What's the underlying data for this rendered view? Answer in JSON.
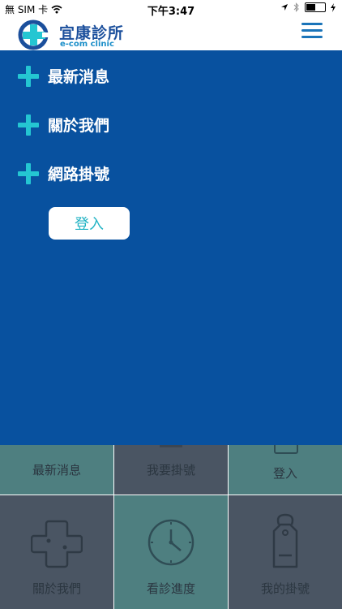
{
  "status_bar": {
    "carrier": "無 SIM 卡",
    "time": "下午3:47",
    "battery_level": 0.55
  },
  "header": {
    "title": "宜康診所",
    "subtitle": "e-com clinic",
    "logo_icon": "e-plus-logo-icon",
    "menu_icon": "hamburger-menu-icon"
  },
  "drawer": {
    "items": [
      {
        "label": "最新消息",
        "icon": "plus-icon"
      },
      {
        "label": "關於我們",
        "icon": "plus-icon"
      },
      {
        "label": "網路掛號",
        "icon": "plus-icon"
      }
    ],
    "login_label": "登入"
  },
  "grid": {
    "tiles": [
      {
        "label": "最新消息"
      },
      {
        "label": "我要掛號"
      },
      {
        "label": "登入"
      },
      {
        "label": "關於我們",
        "icon": "cross-icon"
      },
      {
        "label": "看診進度",
        "icon": "clock-icon"
      },
      {
        "label": "我的掛號",
        "icon": "tag-icon"
      }
    ]
  },
  "colors": {
    "drawer_bg": "#08519f",
    "accent_cyan": "#24c6d2",
    "brand_blue": "#1b4f9c",
    "tile_teal": "#4e7f80",
    "tile_slate": "#4a5563"
  }
}
